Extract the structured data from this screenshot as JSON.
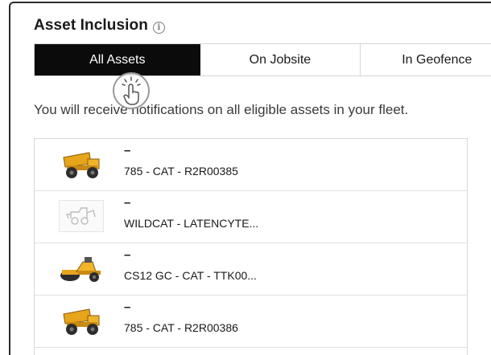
{
  "header": {
    "title": "Asset Inclusion",
    "info_icon": "info-icon"
  },
  "tabs": [
    {
      "label": "All Assets",
      "selected": true
    },
    {
      "label": "On Jobsite",
      "selected": false
    },
    {
      "label": "In Geofence",
      "selected": false
    }
  ],
  "notice": "You will receive notifications on all eligible assets in your fleet.",
  "assets": [
    {
      "dash": "–",
      "name": "785 - CAT - R2R00385",
      "icon": "mining-truck-icon"
    },
    {
      "dash": "–",
      "name": "WILDCAT - LATENCYTE...",
      "icon": "generic-machine-icon"
    },
    {
      "dash": "–",
      "name": "CS12 GC - CAT - TTK00...",
      "icon": "soil-compactor-icon"
    },
    {
      "dash": "–",
      "name": "785 - CAT - R2R00386",
      "icon": "mining-truck-icon"
    }
  ],
  "colors": {
    "tab_active_bg": "#0b0b0b",
    "machine_yellow": "#e7a51c"
  },
  "cursor": {
    "icon": "tap-hand-icon"
  }
}
